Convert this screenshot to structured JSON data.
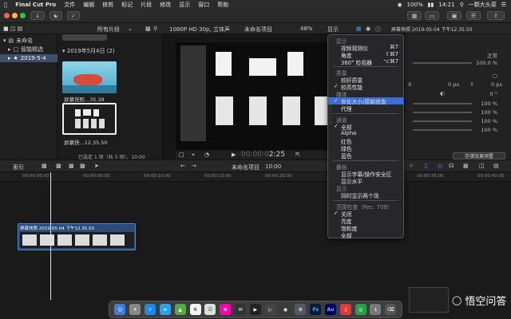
{
  "menubar": {
    "apple": "",
    "items": [
      "Final Cut Pro",
      "文件",
      "编辑",
      "修剪",
      "标记",
      "片段",
      "修改",
      "显示",
      "窗口",
      "帮助"
    ],
    "clock": "14:21",
    "user": "一颗大头菜",
    "battery": "100%"
  },
  "library": {
    "header_filter": "所有片段",
    "project_name_top": "未命名项目",
    "format": "1080P HD 30p, 立体声",
    "zoom": "48%",
    "view_label": "显示",
    "inspector_title": "屏幕快照 2019-05-04 下午12.35.50"
  },
  "sidebar": {
    "library_name": "未命名",
    "smart": "智能精选",
    "event": "2019-5-4"
  },
  "browser": {
    "date_group": "2019年5月4日",
    "date_count": "(2)",
    "clip1": "屏幕快照...35.38",
    "clip2": "屏幕快...12.35.50",
    "status": "已选定 1 项（共 3 项），10:00"
  },
  "viewer": {
    "timecode": "00:00:02:25",
    "tc_prefix": "00:00:0",
    "tc_main": "2:25"
  },
  "inspector": {
    "normal": "正常",
    "pct1": "100.0 %",
    "x": "X",
    "y": "Y",
    "zero_px": "0 px",
    "zero_deg": "0 °",
    "pct2": "100 %",
    "pct3": "100 %",
    "pct4": "100 %",
    "pct5": "100 %",
    "save_preset": "存储效果预置"
  },
  "timeline": {
    "index_label": "索引",
    "project": "未命名项目",
    "duration": "10:00",
    "ruler": [
      "00:00:00:00",
      "00:00:05:00",
      "00:00:10:00",
      "00:00:15:00",
      "00:00:20:00",
      "00:00:35:00",
      "00:00:40:00"
    ],
    "clip_title": "屏幕快照 2019-05-04 下午12.35.50"
  },
  "menu": {
    "h_display": "显示",
    "angle_view": "视频观测仪",
    "angle_sc": "⌘7",
    "angle": "角度",
    "angle_sc2": "⇧⌘7",
    "vr": "360° 检视器",
    "vr_sc": "⌥⌘7",
    "h_quality": "质量",
    "better_q": "较好质量",
    "better_p": "较高性能",
    "h_media": "媒体",
    "optimized": "优化大小/原始状态",
    "proxy": "代理",
    "h_channels": "通道",
    "all": "全部",
    "alpha": "Alpha",
    "red": "红色",
    "green": "绿色",
    "blue": "蓝色",
    "h_overlays": "叠层",
    "title_safe": "显示字幕/操作安全区",
    "horizon": "显示水平",
    "h_show": "显示",
    "two_frames": "同时显示两个场",
    "h_range": "范围检查（Rec. 709）",
    "off": "关闭",
    "luma": "亮度",
    "sat": "饱和度",
    "all2": "全部"
  },
  "dock": {
    "ps": "Ps",
    "au": "Au",
    "cal": "6"
  },
  "watermark": "悟空问答",
  "colors": {
    "accent": "#3b6fd6",
    "clip": "#2c4a77",
    "selection": "#3d4f6b"
  }
}
